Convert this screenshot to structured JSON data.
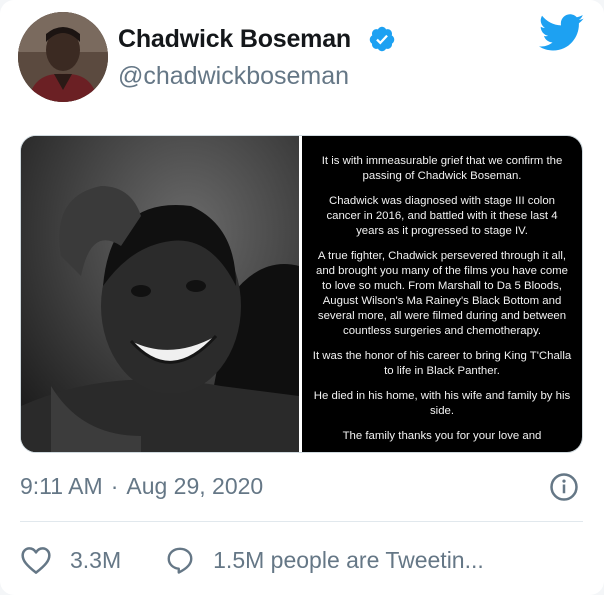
{
  "tweet": {
    "author": {
      "name": "Chadwick Boseman",
      "handle": "@chadwickboseman",
      "verified": true
    },
    "media": {
      "statement_paragraphs": [
        "It is with immeasurable grief that we confirm the passing of Chadwick Boseman.",
        "Chadwick was diagnosed with stage III colon cancer in 2016, and battled with it these last 4 years as it progressed to stage IV.",
        "A true fighter, Chadwick persevered through it all, and brought you many of the films you have come to love so much. From Marshall to Da 5 Bloods, August Wilson's Ma Rainey's Black Bottom and several more, all were filmed during and between countless surgeries and chemotherapy.",
        "It was the honor of his career to bring King T'Challa to life in Black Panther.",
        "He died in his home, with his wife and family by his side.",
        "The family thanks you for your love and"
      ]
    },
    "time": "9:11 AM",
    "separator": "·",
    "date": "Aug 29, 2020",
    "likes": "3.3M",
    "conversation": "1.5M people are Tweetin..."
  },
  "colors": {
    "twitter_blue": "#1da1f2",
    "muted_text": "#657786",
    "name_text": "#14171a"
  },
  "icons": [
    "twitter-bird-icon",
    "verified-badge-icon",
    "info-icon",
    "heart-icon",
    "reply-bubble-icon"
  ]
}
